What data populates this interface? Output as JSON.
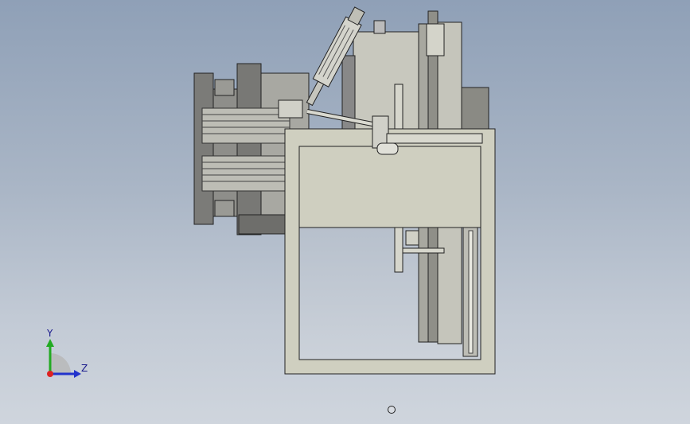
{
  "viewport": {
    "view_orientation": "Right view",
    "background_colors": [
      "#8fa0b7",
      "#cfd5dd"
    ]
  },
  "model": {
    "frame_color": "#cfcfc0",
    "body_color": "#c8c8be",
    "dark_part_color": "#6b6b6b"
  },
  "triad": {
    "y_label": "Y",
    "z_label": "Z",
    "y_color": "#22aa22",
    "z_color": "#2233cc",
    "x_color": "#dd2222"
  },
  "rotation_center_icon": "rotate-center-icon"
}
